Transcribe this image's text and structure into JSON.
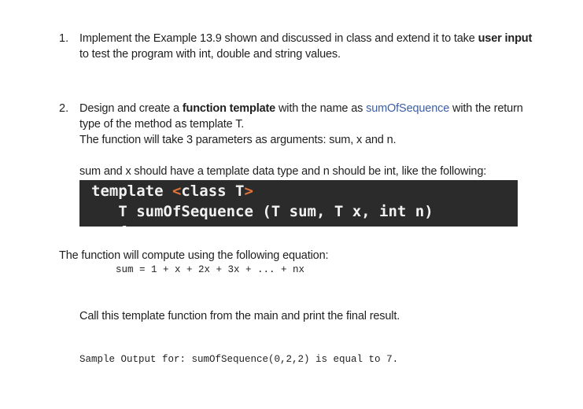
{
  "items": [
    {
      "number": "1.",
      "lines": [
        {
          "pre": "Implement the Example 13.9 shown and discussed in class and extend it to take ",
          "bold": "user input"
        },
        {
          "text": "to test the program with int, double and string values."
        }
      ]
    },
    {
      "number": "2.",
      "line1_pre": "Design and create a ",
      "line1_bold": "function template",
      "line1_mid": " with the name as ",
      "line1_link": "sumOfSequence",
      "line1_post": " with the return",
      "line2": "type of the method as template T.",
      "line3": "The function will take 3 parameters as arguments: sum, x and n.",
      "line4": "sum and x should have a template data type and n should be int, like the following:"
    }
  ],
  "code": {
    "line1_keyword": "template ",
    "line1_lt": "<",
    "line1_body": "class T",
    "line1_gt": ">",
    "line2": "   T sumOfSequence (T sum, T x, int n)",
    "line3_partial": "   {"
  },
  "equation_intro": "The function will compute using the following equation:",
  "equation": "sum = 1 + x + 2x + 3x + ... + nx",
  "call_instruction": "Call this template function from the main and print the final result.",
  "sample_output": "Sample Output for: sumOfSequence(0,2,2) is equal to 7.",
  "colors": {
    "link": "#3b5ea6",
    "code_background": "#2b2b2b",
    "code_text": "#f2f2f2",
    "code_punctuation": "#e0743a"
  }
}
